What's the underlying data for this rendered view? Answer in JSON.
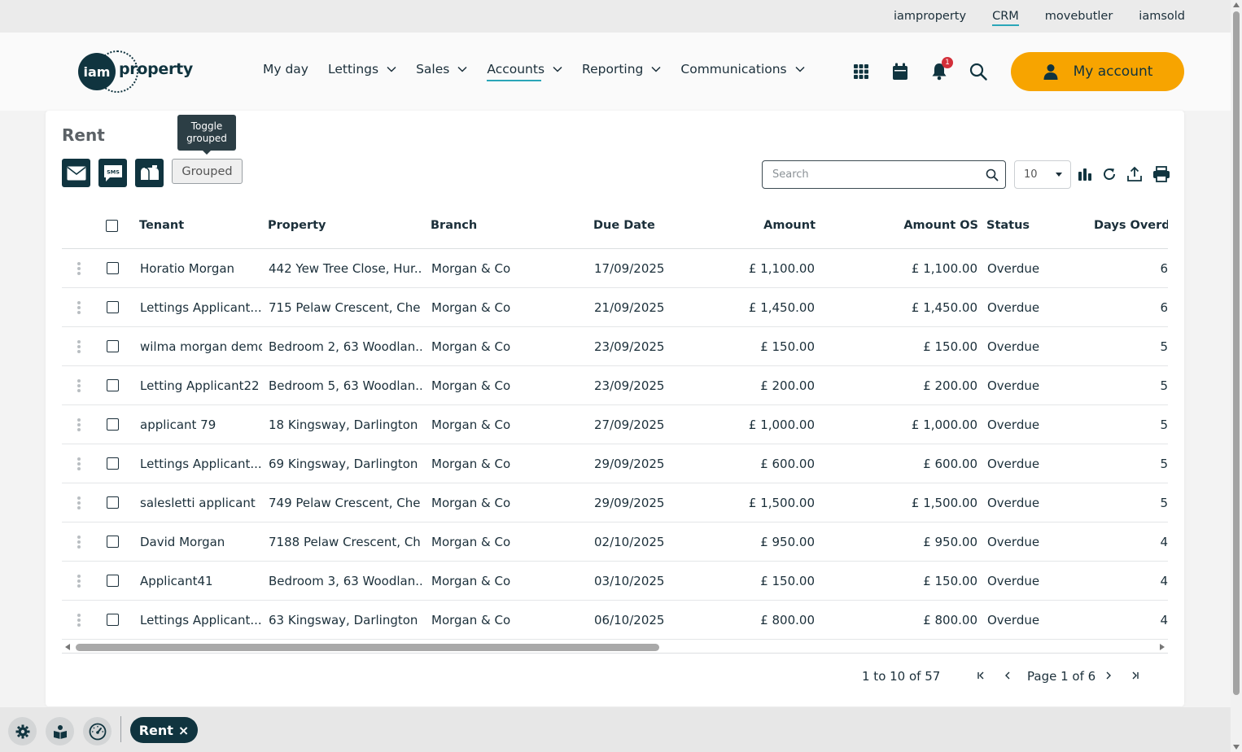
{
  "top_links": [
    {
      "label": "iamproperty",
      "active": false
    },
    {
      "label": "CRM",
      "active": true
    },
    {
      "label": "movebutler",
      "active": false
    },
    {
      "label": "iamsold",
      "active": false
    }
  ],
  "logo": {
    "badge": "iam",
    "word": "property"
  },
  "nav": [
    {
      "label": "My day",
      "dropdown": false,
      "active": false
    },
    {
      "label": "Lettings",
      "dropdown": true,
      "active": false
    },
    {
      "label": "Sales",
      "dropdown": true,
      "active": false
    },
    {
      "label": "Accounts",
      "dropdown": true,
      "active": true
    },
    {
      "label": "Reporting",
      "dropdown": true,
      "active": false
    },
    {
      "label": "Communications",
      "dropdown": true,
      "active": false
    }
  ],
  "header_icons": {
    "apps": "apps-grid-icon",
    "calendar": "calendar-icon",
    "notifications": "bell-icon",
    "notification_count": "1",
    "search": "search-icon"
  },
  "my_account": {
    "label": "My account",
    "icon": "user-icon"
  },
  "page": {
    "title": "Rent",
    "tooltip": "Toggle grouped",
    "tooltip_line1": "Toggle",
    "tooltip_line2": "grouped",
    "action_icons": [
      "email-icon",
      "sms-icon",
      "mailbox-icon"
    ],
    "sms_text": "SMS",
    "grouped_label": "Grouped",
    "search_placeholder": "Search",
    "page_size": "10",
    "tool_icons": [
      "columns-chart-icon",
      "refresh-icon",
      "export-icon",
      "print-icon"
    ]
  },
  "table": {
    "columns": [
      {
        "key": "tenant",
        "label": "Tenant"
      },
      {
        "key": "property",
        "label": "Property"
      },
      {
        "key": "branch",
        "label": "Branch"
      },
      {
        "key": "due_date",
        "label": "Due Date"
      },
      {
        "key": "amount",
        "label": "Amount"
      },
      {
        "key": "amount_os",
        "label": "Amount OS"
      },
      {
        "key": "status",
        "label": "Status"
      },
      {
        "key": "days_overdue",
        "label": "Days Overdu"
      }
    ],
    "rows": [
      {
        "tenant": "Horatio Morgan",
        "property": "442 Yew Tree Close, Hur...",
        "branch": "Morgan & Co",
        "due_date": "17/09/2025",
        "amount": "£ 1,100.00",
        "amount_os": "£ 1,100.00",
        "status": "Overdue",
        "days_overdue": "6"
      },
      {
        "tenant": "Lettings Applicant...",
        "property": "715 Pelaw Crescent, Che...",
        "branch": "Morgan & Co",
        "due_date": "21/09/2025",
        "amount": "£ 1,450.00",
        "amount_os": "£ 1,450.00",
        "status": "Overdue",
        "days_overdue": "6"
      },
      {
        "tenant": "wilma morgan demo",
        "property": "Bedroom 2, 63 Woodlan...",
        "branch": "Morgan & Co",
        "due_date": "23/09/2025",
        "amount": "£ 150.00",
        "amount_os": "£ 150.00",
        "status": "Overdue",
        "days_overdue": "5"
      },
      {
        "tenant": "Letting Applicant22",
        "property": "Bedroom 5, 63 Woodlan...",
        "branch": "Morgan & Co",
        "due_date": "23/09/2025",
        "amount": "£ 200.00",
        "amount_os": "£ 200.00",
        "status": "Overdue",
        "days_overdue": "5"
      },
      {
        "tenant": "applicant 79",
        "property": "18 Kingsway, Darlington",
        "branch": "Morgan & Co",
        "due_date": "27/09/2025",
        "amount": "£ 1,000.00",
        "amount_os": "£ 1,000.00",
        "status": "Overdue",
        "days_overdue": "5"
      },
      {
        "tenant": "Lettings Applicant...",
        "property": "69 Kingsway, Darlington",
        "branch": "Morgan & Co",
        "due_date": "29/09/2025",
        "amount": "£ 600.00",
        "amount_os": "£ 600.00",
        "status": "Overdue",
        "days_overdue": "5"
      },
      {
        "tenant": "salesletti applicant",
        "property": "749 Pelaw Crescent, Che...",
        "branch": "Morgan & Co",
        "due_date": "29/09/2025",
        "amount": "£ 1,500.00",
        "amount_os": "£ 1,500.00",
        "status": "Overdue",
        "days_overdue": "5"
      },
      {
        "tenant": "David Morgan",
        "property": "7188 Pelaw Crescent, Ch...",
        "branch": "Morgan & Co",
        "due_date": "02/10/2025",
        "amount": "£ 950.00",
        "amount_os": "£ 950.00",
        "status": "Overdue",
        "days_overdue": "4"
      },
      {
        "tenant": "Applicant41",
        "property": "Bedroom 3, 63 Woodlan...",
        "branch": "Morgan & Co",
        "due_date": "03/10/2025",
        "amount": "£ 150.00",
        "amount_os": "£ 150.00",
        "status": "Overdue",
        "days_overdue": "4"
      },
      {
        "tenant": "Lettings Applicant...",
        "property": "63 Kingsway, Darlington",
        "branch": "Morgan & Co",
        "due_date": "06/10/2025",
        "amount": "£ 800.00",
        "amount_os": "£ 800.00",
        "status": "Overdue",
        "days_overdue": "4"
      }
    ]
  },
  "pagination": {
    "summary": "1 to 10 of 57",
    "page_label": "Page 1 of 6"
  },
  "bottom_bar": {
    "icons": [
      "settings-icon",
      "knowledge-icon",
      "dashboard-gauge-icon"
    ],
    "tab_label": "Rent",
    "tab_close": "×"
  },
  "colors": {
    "brand_dark": "#10343f",
    "accent_teal": "#2aa6b8",
    "account_orange": "#f7a400",
    "badge_red": "#d32f3a"
  }
}
